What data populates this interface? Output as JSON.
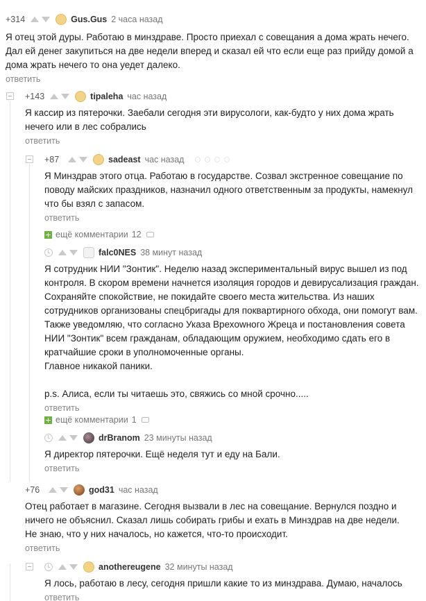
{
  "reply_label": "ответить",
  "comments": [
    {
      "rating": "+314",
      "author": "Gus.Gus",
      "time": "2 часа назад",
      "text": "Я отец этой дуры. Работаю в минздраве. Просто приехал с совещания а дома жрать нечего. Дал ей денег закупиться на две недели вперед и сказал ей что если еще раз прийду домой а дома жрать нечего то она уедет далеко."
    },
    {
      "rating": "+143",
      "author": "tipaleha",
      "time": "час назад",
      "text": "Я кассир из пятерочки. Заебали сегодня эти вирусологи, как-будто у них дома жрать нечего или в лес собрались"
    },
    {
      "rating": "+87",
      "author": "sadeast",
      "time": "час назад",
      "text": "Я Минздрав этого отца. Работаю в государстве. Созвал экстренное совещание по поводу майских праздников, назначил одного ответственным за продукты, намекнул что бы взял с запасом."
    },
    {
      "rating": "",
      "author": "falc0NES",
      "time": "38 минут назад",
      "text": "Я сотрудник НИИ \"Зонтик\". Неделю назад экспериментальный вирус вышел из под контроля. В скором времени начнется изоляция городов и девирусализация граждан. Сохраняйте спокойствие, не покидайте своего места жительства. Из наших сотрудников организованы спецбригады для поквартирного обхода, они помогут вам. Также уведомляю, что согласно Указа Врехowного Жреца и постановления совета НИИ \"Зонтик\" всем гражданам, обладающим оружием, необходимо сдать его в кратчайшие сроки в уполномоченные органы.\nГлавное никакой паники.\n\np.s. Алиса, если ты читаешь это, свяжись со мной срочно....."
    },
    {
      "rating": "",
      "author": "drBranom",
      "time": "23 минуты назад",
      "text": "Я директор пятерочки. Ещё неделя тут и еду на Бали."
    },
    {
      "rating": "+76",
      "author": "god31",
      "time": "час назад",
      "text": "Отец работает в магазине. Сегодня вызвали в лес на совещание. Вернулся поздно и ничего не объяснил. Сказал лишь собирать грибы и ехать в Минздрав на две недели. Не знаю, что у них началось, но кажется, что-то происходит."
    },
    {
      "rating": "",
      "author": "anothereugene",
      "time": "32 минуты назад",
      "text": "Я лось, работаю в лесу, сегодня пришли какие то из минздрава. Думаю, началось"
    }
  ],
  "more_comments": [
    {
      "label": "ещё комментарии",
      "count": "12"
    },
    {
      "label": "ещё комментарии",
      "count": "1"
    }
  ]
}
